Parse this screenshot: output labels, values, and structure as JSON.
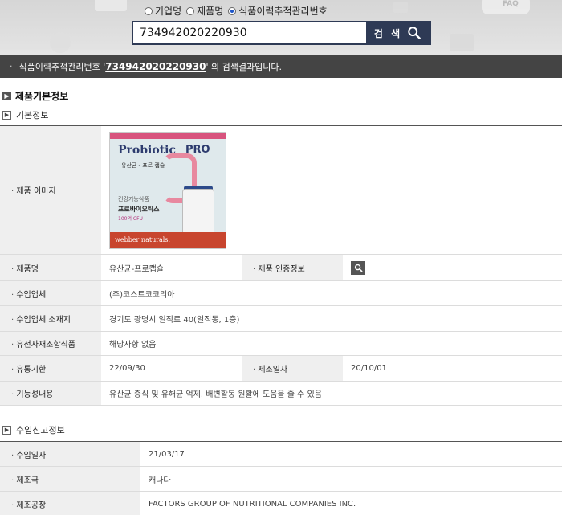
{
  "search": {
    "radio_options": [
      {
        "label": "기업명",
        "checked": false
      },
      {
        "label": "제품명",
        "checked": false
      },
      {
        "label": "식품이력추적관리번호",
        "checked": true
      }
    ],
    "query_value": "734942020220930",
    "button_label": "검 색",
    "faq_text": "FAQ"
  },
  "result_banner": {
    "prefix": "식품이력추적관리번호 '",
    "query": "734942020220930",
    "suffix": "' 의 검색결과입니다."
  },
  "product_basic": {
    "section_title": "제품기본정보",
    "subsection_title": "기본정보",
    "image_label": "제품 이미지",
    "image_text": {
      "title": "Probiotic",
      "pro": "PRO",
      "korean_name": "유산균 - 프로 캡슐",
      "line1": "건강기능식품",
      "line2": "프로바이오틱스",
      "line3": "100억 CFU",
      "brand": "webber naturals."
    },
    "product_name_label": "제품명",
    "product_name": "유산균-프로캡슐",
    "certification_label": "제품 인증정보",
    "importer_label": "수입업체",
    "importer": "(주)코스트코코리아",
    "importer_address_label": "수입업체 소재지",
    "importer_address": "경기도 광명시 일직로 40(일직동, 1층)",
    "gmo_label": "유전자재조합식품",
    "gmo": "해당사항 없음",
    "expiry_label": "유통기한",
    "expiry": "22/09/30",
    "manufacture_date_label": "제조일자",
    "manufacture_date": "20/10/01",
    "function_label": "기능성내용",
    "function": "유산균 증식 및 유해균 억제. 배변활동 원활에 도움을 줄 수 있음"
  },
  "import_report": {
    "section_title": "수입신고정보",
    "import_date_label": "수입일자",
    "import_date": "21/03/17",
    "country_label": "제조국",
    "country": "캐나다",
    "factory_label": "제조공장",
    "factory": "FACTORS GROUP OF NUTRITIONAL COMPANIES INC."
  },
  "colors": {
    "search_box": "#2e3a55",
    "banner": "#444444",
    "header_cell": "#efefef",
    "radio_selected": "#1e56c9"
  },
  "icons": {
    "search": "magnifier-icon",
    "certification": "magnifier-icon",
    "section_marker": "chevron-right-icon"
  }
}
